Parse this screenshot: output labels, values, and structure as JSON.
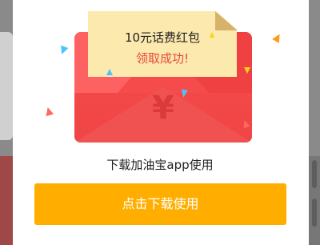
{
  "popup": {
    "note_title": "10元话费红包",
    "note_status": "领取成功!",
    "envelope_symbol": "¥",
    "hint": "下载加油宝app使用",
    "button_label": "点击下载使用"
  },
  "colors": {
    "button": "#ffae00",
    "envelope": "#f64b4b",
    "note": "#fbe9ad",
    "status_text": "#e8493a"
  }
}
